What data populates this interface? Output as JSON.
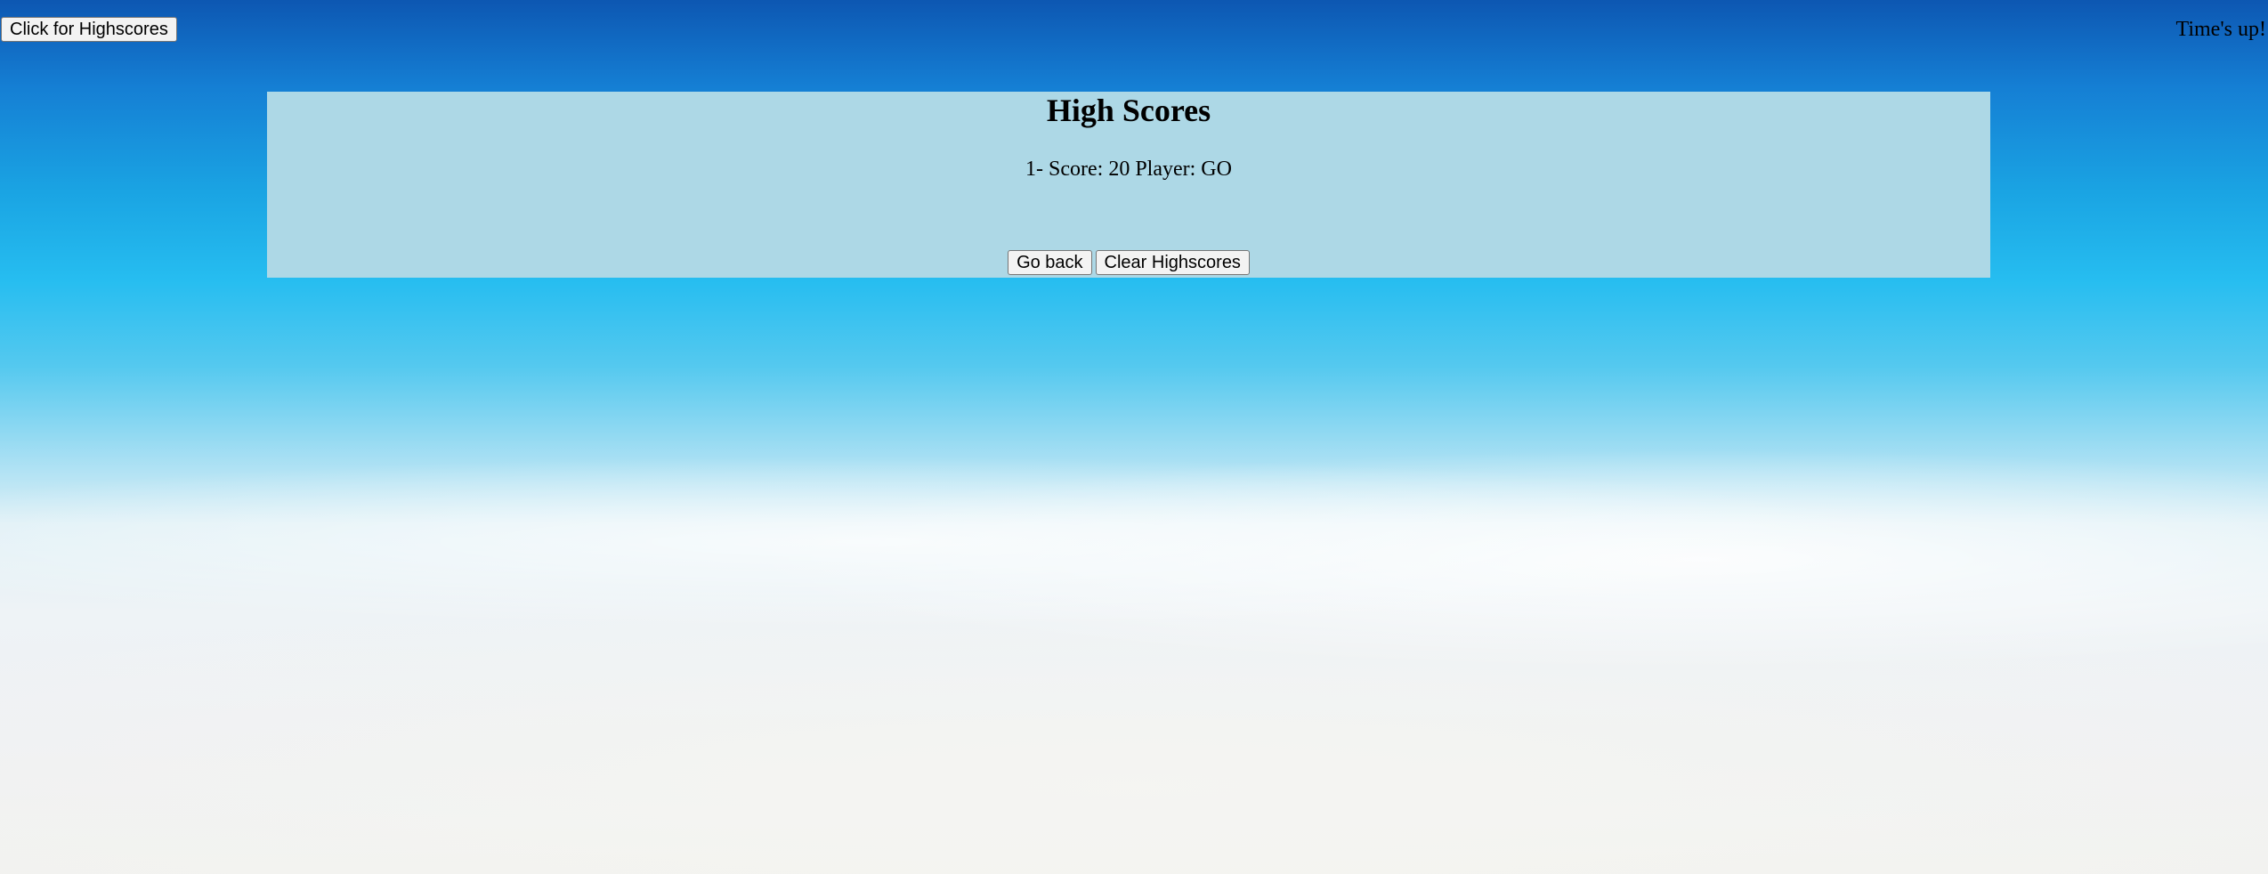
{
  "header": {
    "highscores_button_label": "Click for Highscores",
    "timer_text": "Time's up!"
  },
  "highscores": {
    "title": "High Scores",
    "entries": [
      {
        "text": "1- Score: 20 Player: GO"
      }
    ],
    "go_back_label": "Go back",
    "clear_label": "Clear Highscores"
  },
  "colors": {
    "panel_background": "#add8e6",
    "sky_top": "#0d57b2",
    "sky_bottom": "#f2f2ef"
  }
}
